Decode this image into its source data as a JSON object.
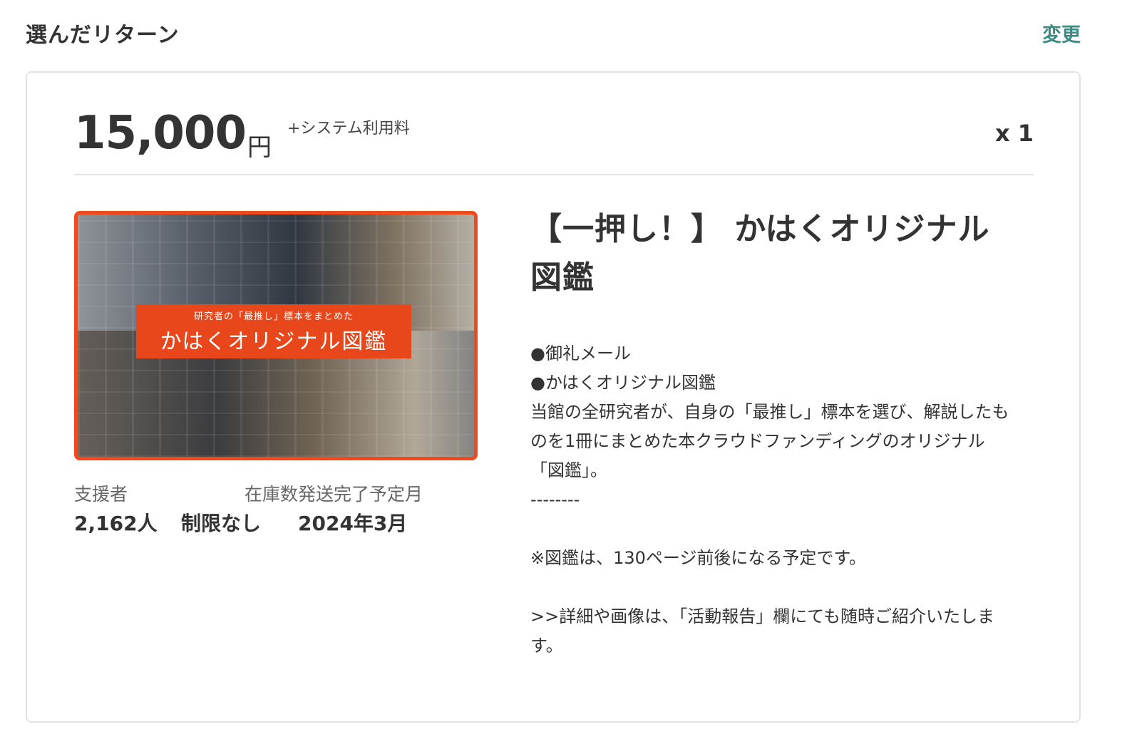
{
  "header": {
    "title": "選んだリターン",
    "change_label": "変更"
  },
  "reward": {
    "price": "15,000",
    "currency": "円",
    "fee_note": "+システム利用料",
    "quantity": "x 1",
    "image": {
      "banner_sub": "研究者の「最推し」標本をまとめた",
      "banner_main": "かはくオリジナル図鑑"
    },
    "stats": [
      {
        "label": "支援者",
        "value": "2,162人"
      },
      {
        "label": "在庫数",
        "value": "制限なし"
      },
      {
        "label": "発送完了予定月",
        "value": "2024年3月"
      }
    ],
    "title": "【一押し！】 かはくオリジナル図鑑",
    "description": "●御礼メール\n●かはくオリジナル図鑑\n当館の全研究者が、自身の「最推し」標本を選び、解説したものを1冊にまとめた本クラウドファンディングのオリジナル「図鑑」。\n--------\n\n※図鑑は、130ページ前後になる予定です。\n\n>>詳細や画像は、「活動報告」欄にても随時ご紹介いたします。"
  },
  "colors": {
    "accent_link": "#3d8a85",
    "image_border": "#ee4a1c",
    "banner_bg": "#e8461b"
  }
}
